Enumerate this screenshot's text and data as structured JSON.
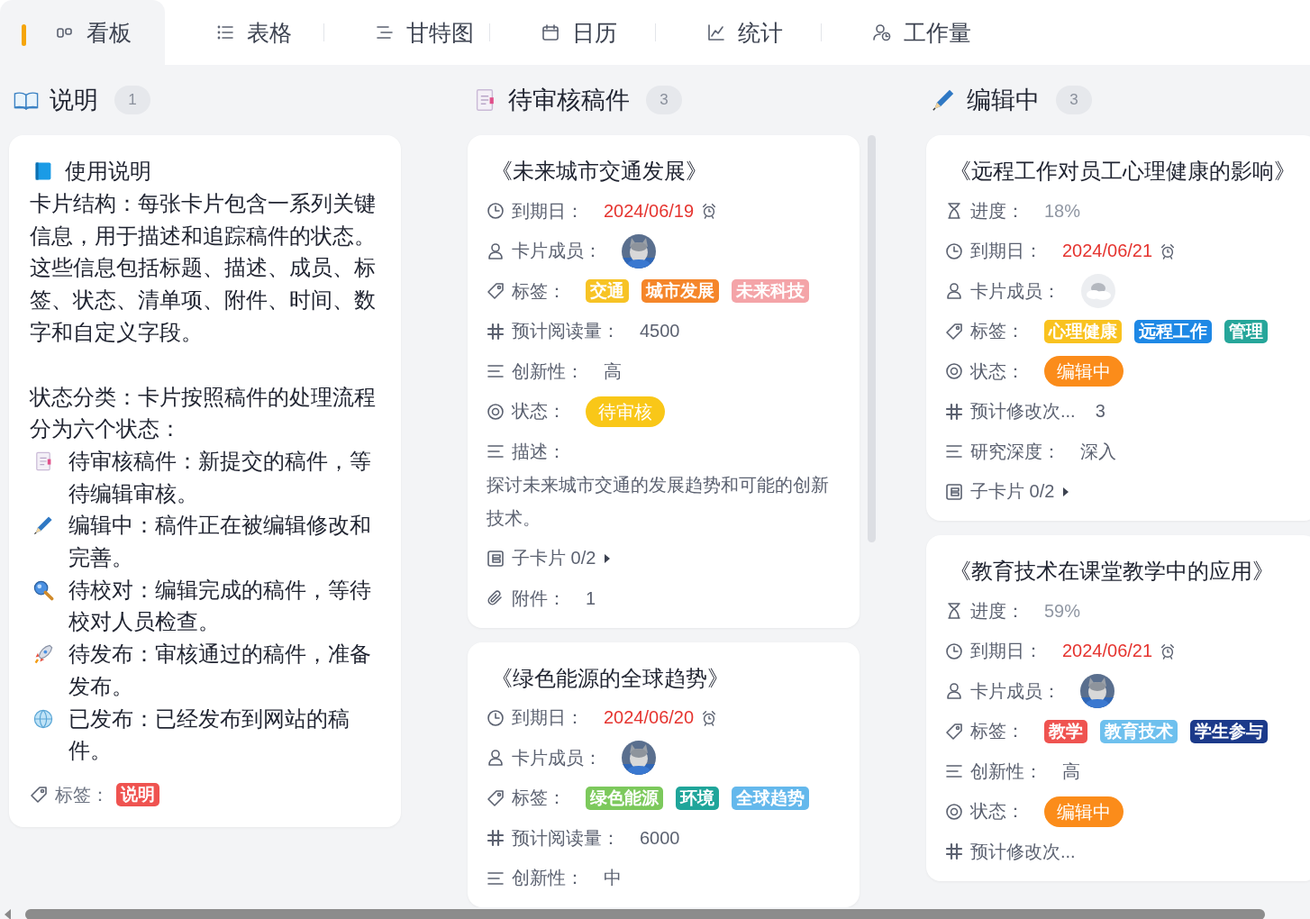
{
  "tabs": [
    {
      "label": "看板",
      "selected": true
    },
    {
      "label": "表格",
      "selected": false
    },
    {
      "label": "甘特图",
      "selected": false
    },
    {
      "label": "日历",
      "selected": false
    },
    {
      "label": "统计",
      "selected": false
    },
    {
      "label": "工作量",
      "selected": false
    }
  ],
  "columns": [
    {
      "title": "说明",
      "count": "1",
      "cards": [
        {
          "kind": "note",
          "title": "使用说明",
          "blocks": [
            {
              "kind": "text",
              "text": "卡片结构：每张卡片包含一系列关键信息，用于描述和追踪稿件的状态。这些信息包括标题、描述、成员、标签、状态、清单项、附件、时间、数字和自定义字段。"
            },
            {
              "kind": "section",
              "text": "状态分类：卡片按照稿件的处理流程分为六个状态："
            },
            {
              "kind": "item",
              "text": "待审核稿件：新提交的稿件，等待编辑审核。"
            },
            {
              "kind": "item",
              "text": "编辑中：稿件正在被编辑修改和完善。"
            },
            {
              "kind": "item",
              "text": "待校对：编辑完成的稿件，等待校对人员检查。"
            },
            {
              "kind": "item",
              "text": "待发布：审核通过的稿件，准备发布。"
            },
            {
              "kind": "item",
              "text": "已发布：已经发布到网站的稿件。"
            }
          ],
          "tag_label": "标签：",
          "tags": [
            {
              "text": "说明",
              "color": "#ef5350"
            }
          ]
        }
      ]
    },
    {
      "title": "待审核稿件",
      "count": "3",
      "scrollbar": true,
      "cards": [
        {
          "kind": "task",
          "title": "《未来城市交通发展》",
          "fields": [
            {
              "kind": "date",
              "label": "到期日：",
              "value": "2024/06/19"
            },
            {
              "kind": "members",
              "label": "卡片成员：",
              "default_avatar": false
            },
            {
              "kind": "tags",
              "label": "标签：",
              "tags": [
                {
                  "text": "交通",
                  "color": "#f7c325"
                },
                {
                  "text": "城市发展",
                  "color": "#f5862a"
                },
                {
                  "text": "未来科技",
                  "color": "#f4a4a8"
                }
              ]
            },
            {
              "kind": "number",
              "label": "预计阅读量：",
              "value": "4500"
            },
            {
              "kind": "select",
              "label": "创新性：",
              "value": "高"
            },
            {
              "kind": "status",
              "label": "状态：",
              "status": {
                "text": "待审核",
                "color": "#f9c718"
              }
            },
            {
              "kind": "description",
              "label": "描述：",
              "text": "探讨未来城市交通的发展趋势和可能的创新技术。"
            },
            {
              "kind": "subcards",
              "label": "子卡片 0/2"
            },
            {
              "kind": "attachment",
              "label": "附件：",
              "value": "1"
            }
          ]
        },
        {
          "kind": "task",
          "title": "《绿色能源的全球趋势》",
          "fields": [
            {
              "kind": "date",
              "label": "到期日：",
              "value": "2024/06/20"
            },
            {
              "kind": "members",
              "label": "卡片成员：",
              "default_avatar": false
            },
            {
              "kind": "tags",
              "label": "标签：",
              "tags": [
                {
                  "text": "绿色能源",
                  "color": "#7cc95c"
                },
                {
                  "text": "环境",
                  "color": "#1fa59a"
                },
                {
                  "text": "全球趋势",
                  "color": "#64b8ec"
                }
              ]
            },
            {
              "kind": "number",
              "label": "预计阅读量：",
              "value": "6000"
            },
            {
              "kind": "select",
              "label": "创新性：",
              "value": "中"
            }
          ]
        }
      ]
    },
    {
      "title": "编辑中",
      "count": "3",
      "cards": [
        {
          "kind": "task",
          "title": "《远程工作对员工心理健康的影响》",
          "fields": [
            {
              "kind": "progress",
              "label": "进度：",
              "value": "18%"
            },
            {
              "kind": "date",
              "label": "到期日：",
              "value": "2024/06/21"
            },
            {
              "kind": "members",
              "label": "卡片成员：",
              "default_avatar": true
            },
            {
              "kind": "tags",
              "label": "标签：",
              "tags": [
                {
                  "text": "心理健康",
                  "color": "#f9c21f"
                },
                {
                  "text": "远程工作",
                  "color": "#1e88e5"
                },
                {
                  "text": "管理",
                  "color": "#26a69a"
                }
              ]
            },
            {
              "kind": "status",
              "label": "状态：",
              "status": {
                "text": "编辑中",
                "color": "#fb8c1a"
              }
            },
            {
              "kind": "number",
              "label": "预计修改次...",
              "value": "3"
            },
            {
              "kind": "select",
              "label": "研究深度：",
              "value": "深入"
            },
            {
              "kind": "subcards",
              "label": "子卡片 0/2"
            }
          ]
        },
        {
          "kind": "task",
          "title": "《教育技术在课堂教学中的应用》",
          "fields": [
            {
              "kind": "progress",
              "label": "进度：",
              "value": "59%"
            },
            {
              "kind": "date",
              "label": "到期日：",
              "value": "2024/06/21"
            },
            {
              "kind": "members",
              "label": "卡片成员：",
              "default_avatar": false
            },
            {
              "kind": "tags",
              "label": "标签：",
              "tags": [
                {
                  "text": "教学",
                  "color": "#ef5350"
                },
                {
                  "text": "教育技术",
                  "color": "#6ec0ee"
                },
                {
                  "text": "学生参与",
                  "color": "#1c3a8a"
                }
              ]
            },
            {
              "kind": "select",
              "label": "创新性：",
              "value": "高"
            },
            {
              "kind": "status",
              "label": "状态：",
              "status": {
                "text": "编辑中",
                "color": "#fb8c1a"
              }
            },
            {
              "kind": "number",
              "label": "预计修改次..."
            }
          ]
        }
      ]
    }
  ]
}
